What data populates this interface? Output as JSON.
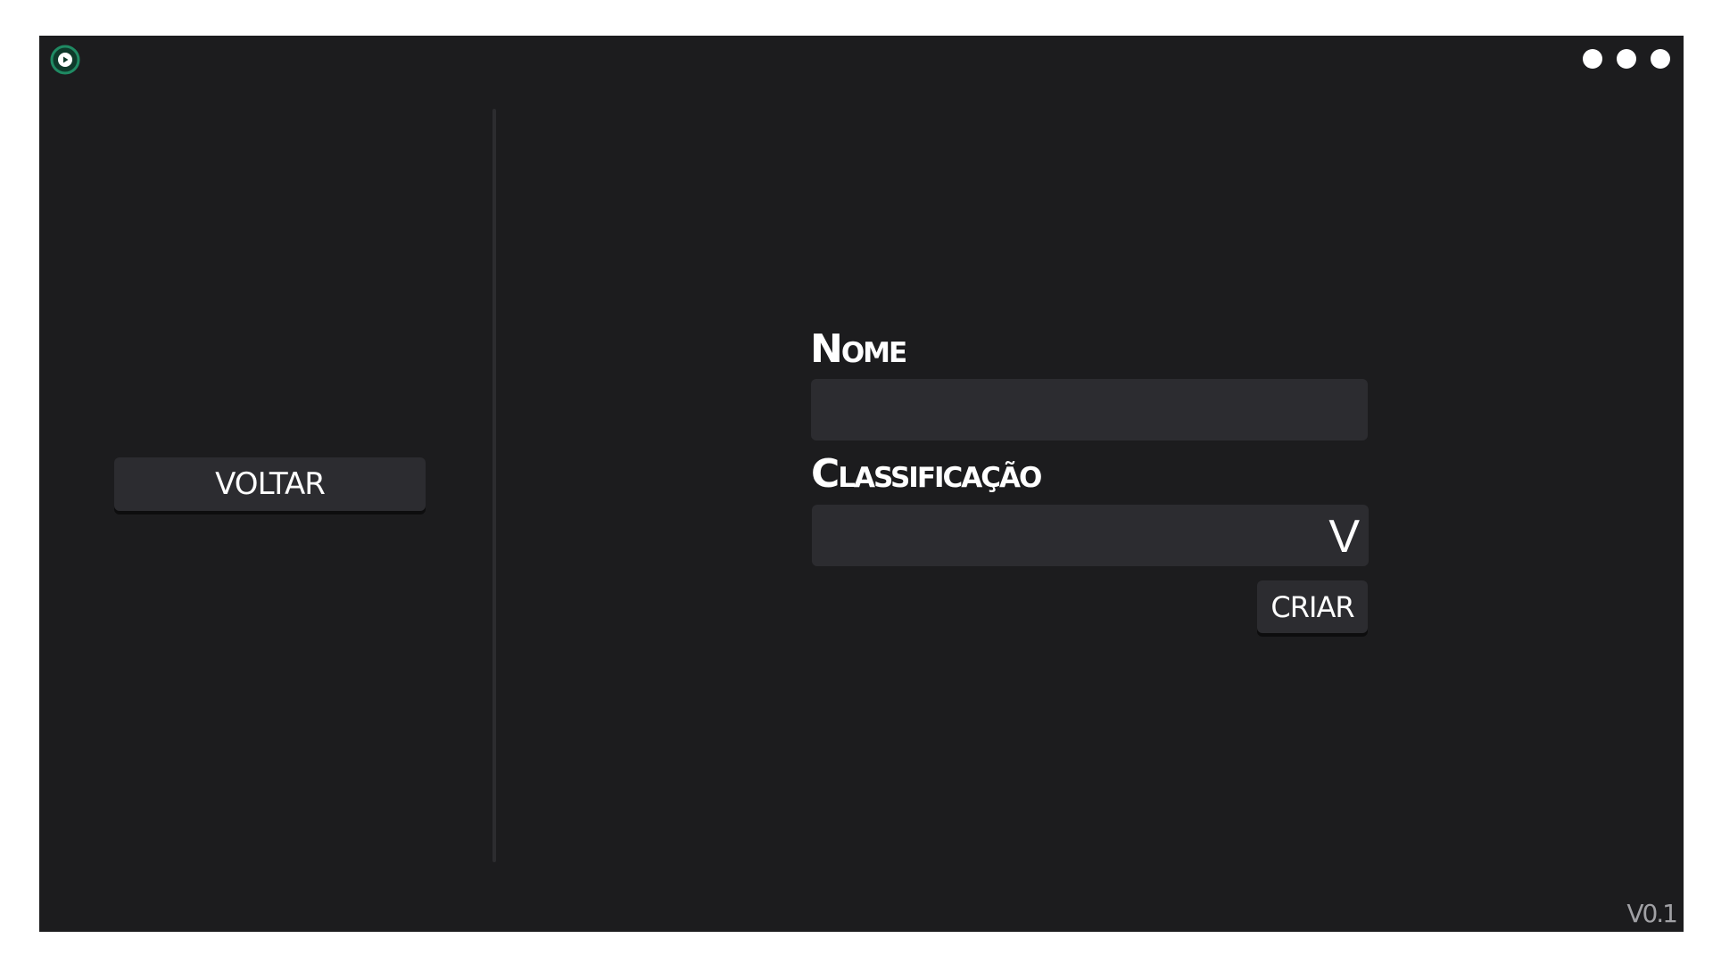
{
  "app": {
    "logo_icon": "play-circle-icon",
    "accent_color": "#1f8a63",
    "version": "V0.1"
  },
  "window_controls": {
    "icons": [
      "dot-icon",
      "dot-icon",
      "dot-icon"
    ]
  },
  "sidebar": {
    "back_label": "VOLTAR"
  },
  "form": {
    "name_label": "Nome",
    "name_value": "",
    "classification_label": "Classificação",
    "classification_value": "",
    "dropdown_glyph": "V",
    "create_label": "CRIAR"
  }
}
